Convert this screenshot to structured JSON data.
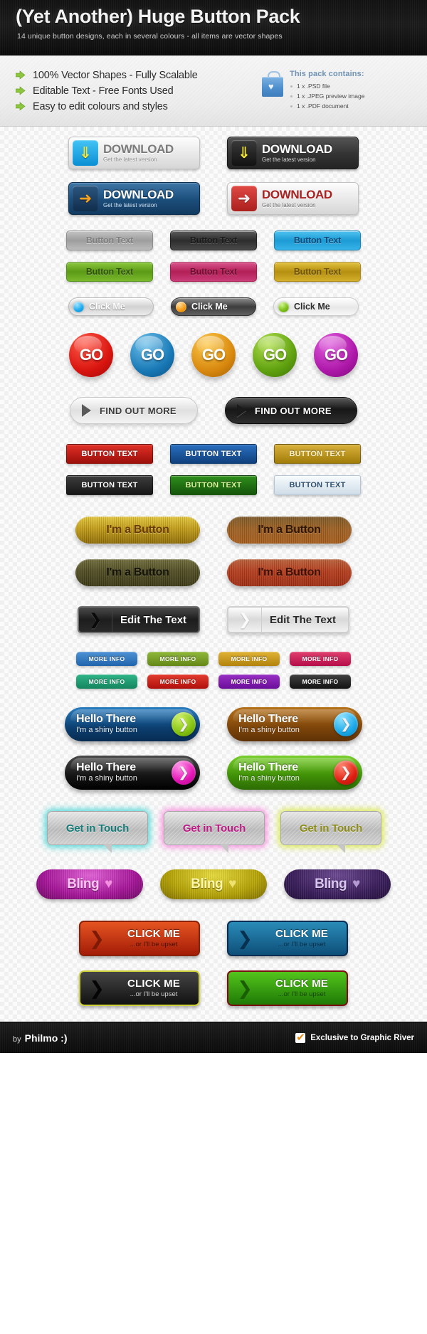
{
  "header": {
    "title": "(Yet Another) Huge Button Pack",
    "subtitle": "14 unique button designs, each in several colours - all items are vector shapes"
  },
  "info": {
    "features": [
      "100% Vector Shapes - Fully Scalable",
      "Editable Text - Free Fonts Used",
      "Easy to edit colours and styles"
    ],
    "pack_title": "This pack contains:",
    "pack_items": [
      "1 x .PSD file",
      "1 x .JPEG preview image",
      "1 x .PDF document"
    ]
  },
  "sections": {
    "download": {
      "title_label": "DOWNLOAD",
      "sub_label": "Get the latest version",
      "variants": [
        "light",
        "dark",
        "blue",
        "red"
      ]
    },
    "button_text_glossy": {
      "label": "Button Text",
      "colors": [
        "grey",
        "black",
        "blue",
        "green",
        "pink",
        "gold"
      ]
    },
    "click_me_pill": {
      "label": "Click Me",
      "variants": [
        "silver-blue-led",
        "dark-orange-led",
        "white-green-led"
      ]
    },
    "go_balls": {
      "label": "GO",
      "colors": [
        "red",
        "blue",
        "orange",
        "green",
        "purple"
      ]
    },
    "find_out_more": {
      "label": "FIND OUT MORE",
      "variants": [
        "light",
        "dark"
      ]
    },
    "button_text_flat": {
      "label": "BUTTON TEXT",
      "colors": [
        "red",
        "blue",
        "gold",
        "black",
        "green",
        "white"
      ]
    },
    "wooden": {
      "label": "I'm a Button",
      "colors": [
        "gold",
        "brown",
        "olive",
        "rust"
      ]
    },
    "edit_the_text": {
      "label": "Edit The Text",
      "variants": [
        "dark",
        "light"
      ]
    },
    "more_info": {
      "label": "MORE INFO",
      "colors": [
        "blue",
        "green",
        "gold",
        "pink",
        "teal",
        "red",
        "purple",
        "black"
      ]
    },
    "hello_there": {
      "title": "Hello There",
      "subtitle": "I'm a shiny button",
      "variants": [
        "blue",
        "brown",
        "black",
        "green"
      ]
    },
    "get_in_touch": {
      "label": "Get in Touch",
      "colors": [
        "teal",
        "pink",
        "yellow"
      ]
    },
    "bling": {
      "label": "Bling",
      "heart": "♥",
      "colors": [
        "magenta",
        "gold",
        "purple"
      ]
    },
    "click_me_big": {
      "title": "CLICK ME",
      "subtitle": "...or I'll be upset",
      "variants": [
        "orange",
        "blue",
        "black",
        "green"
      ]
    }
  },
  "footer": {
    "by_prefix": "by",
    "author": "Philmo :)",
    "exclusive": "Exclusive to Graphic River"
  },
  "glyphs": {
    "double_down": "⇓",
    "arrow_right": "➜",
    "chevron_right": "❯",
    "triangle_right": "▶"
  }
}
